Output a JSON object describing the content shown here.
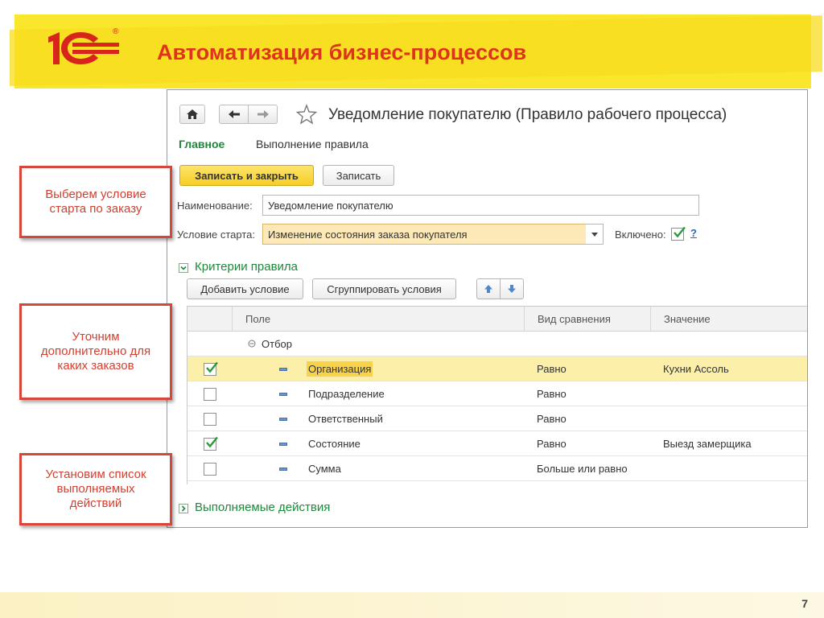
{
  "slide": {
    "title": "Автоматизация бизнес-процессов",
    "page_number": "7",
    "accent_color": "#e0331d",
    "band_color": "#fbe62e"
  },
  "logo": {
    "text": "1С",
    "reg_mark": "®"
  },
  "window": {
    "title": "Уведомление покупателю (Правило рабочего процесса)",
    "toolbar_icons": [
      "home-icon",
      "back-arrow-icon",
      "forward-arrow-icon",
      "star-icon"
    ]
  },
  "tabs": {
    "main": "Главное",
    "execution": "Выполнение правила"
  },
  "actions": {
    "save_close": "Записать и закрыть",
    "save": "Записать"
  },
  "form": {
    "name_label": "Наименование:",
    "name_value": "Уведомление покупателю",
    "start_label": "Условие старта:",
    "start_value": "Изменение состояния заказа покупателя",
    "enabled_label": "Включено:",
    "enabled": true,
    "help": "?"
  },
  "criteria": {
    "title": "Критерии правила",
    "add_condition": "Добавить условие",
    "group_conditions": "Сгруппировать условия",
    "columns": {
      "field": "Поле",
      "comparison": "Вид сравнения",
      "value": "Значение"
    },
    "group_row": "Отбор",
    "rows": [
      {
        "checked": true,
        "field": "Организация",
        "comparison": "Равно",
        "value": "Кухни Ассоль"
      },
      {
        "checked": false,
        "field": "Подразделение",
        "comparison": "Равно",
        "value": ""
      },
      {
        "checked": false,
        "field": "Ответственный",
        "comparison": "Равно",
        "value": ""
      },
      {
        "checked": true,
        "field": "Состояние",
        "comparison": "Равно",
        "value": "Выезд замерщика"
      },
      {
        "checked": false,
        "field": "Сумма",
        "comparison": "Больше или равно",
        "value": ""
      }
    ]
  },
  "actions_section": {
    "title": "Выполняемые действия"
  },
  "callouts": [
    "Выберем условие\nстарта по заказу",
    "Уточним\nдополнительно для\nкаких заказов",
    "Установим список\nвыполняемых\nдействий"
  ]
}
